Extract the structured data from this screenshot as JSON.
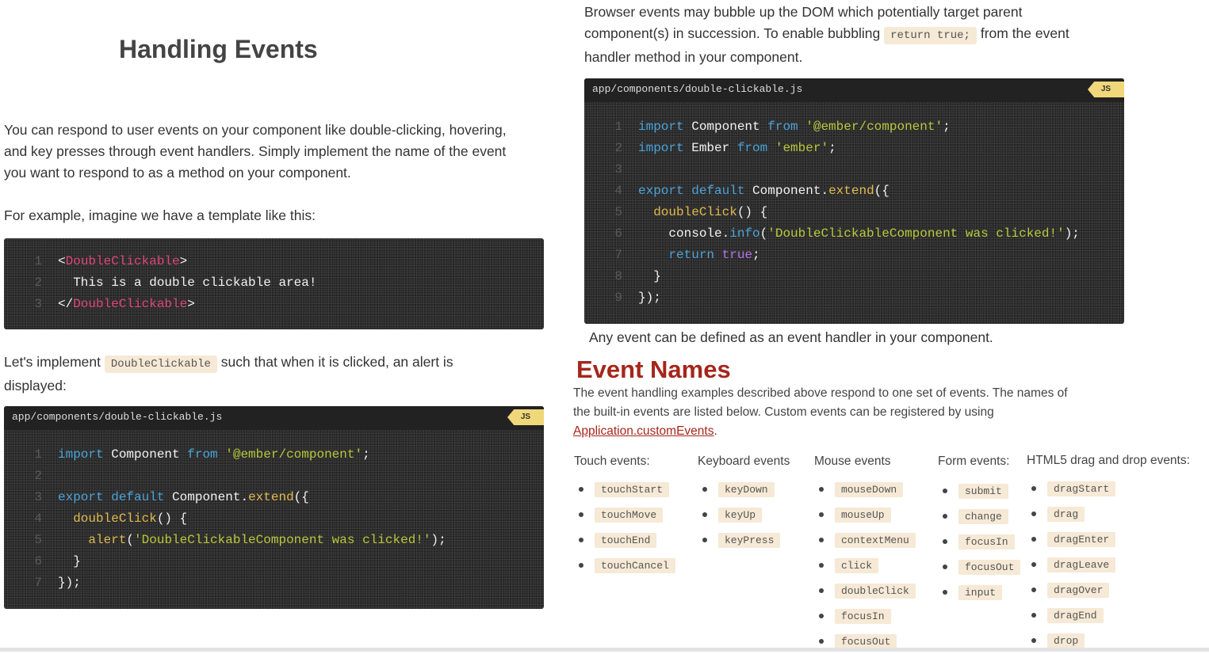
{
  "left": {
    "title": "Handling Events",
    "intro_lines": [
      "You can respond to user events on your component like double-clicking, hovering,",
      "and key presses through event handlers. Simply implement the name of the event",
      "you want to respond to as a method on your component."
    ],
    "example_intro": "For example, imagine we have a template like this:",
    "template_code": {
      "lines": [
        {
          "num": "1",
          "parts": [
            [
              "plain",
              "<"
            ],
            [
              "tag",
              "DoubleClickable"
            ],
            [
              "plain",
              ">"
            ]
          ]
        },
        {
          "num": "2",
          "parts": [
            [
              "plain",
              "  This is a double clickable area!"
            ]
          ]
        },
        {
          "num": "3",
          "parts": [
            [
              "plain",
              "</"
            ],
            [
              "tag",
              "DoubleClickable"
            ],
            [
              "plain",
              ">"
            ]
          ]
        }
      ]
    },
    "implement_pre": "Let's implement",
    "implement_code": "DoubleClickable",
    "implement_post": "such that when it is clicked, an alert is",
    "implement_post2": "displayed:",
    "code2": {
      "filename": "app/components/double-clickable.js",
      "lang": "JS",
      "lines": [
        {
          "num": "1",
          "parts": [
            [
              "kw",
              "import"
            ],
            [
              "plain",
              " Component "
            ],
            [
              "kw",
              "from"
            ],
            [
              "plain",
              " "
            ],
            [
              "str",
              "'@ember/component'"
            ],
            [
              "plain",
              ";"
            ]
          ]
        },
        {
          "num": "2",
          "parts": [
            [
              "plain",
              ""
            ]
          ]
        },
        {
          "num": "3",
          "parts": [
            [
              "kw",
              "export"
            ],
            [
              "plain",
              " "
            ],
            [
              "kw",
              "default"
            ],
            [
              "plain",
              " Component."
            ],
            [
              "fn",
              "extend"
            ],
            [
              "plain",
              "({"
            ]
          ]
        },
        {
          "num": "4",
          "parts": [
            [
              "plain",
              "  "
            ],
            [
              "fn",
              "doubleClick"
            ],
            [
              "plain",
              "() {"
            ]
          ]
        },
        {
          "num": "5",
          "parts": [
            [
              "plain",
              "    "
            ],
            [
              "fn",
              "alert"
            ],
            [
              "plain",
              "("
            ],
            [
              "str",
              "'DoubleClickableComponent was clicked!'"
            ],
            [
              "plain",
              ");"
            ]
          ]
        },
        {
          "num": "6",
          "parts": [
            [
              "plain",
              "  }"
            ]
          ]
        },
        {
          "num": "7",
          "parts": [
            [
              "plain",
              "});"
            ]
          ]
        }
      ]
    }
  },
  "right": {
    "bubble_line1": "Browser events may bubble up the DOM which potentially target parent",
    "bubble_line2_pre": "component(s) in succession. To enable bubbling",
    "bubble_code": "return true;",
    "bubble_line2_post": "from the event",
    "bubble_line3": "handler method in your component.",
    "code3": {
      "filename": "app/components/double-clickable.js",
      "lang": "JS",
      "lines": [
        {
          "num": "1",
          "parts": [
            [
              "kw",
              "import"
            ],
            [
              "plain",
              " Component "
            ],
            [
              "kw",
              "from"
            ],
            [
              "plain",
              " "
            ],
            [
              "str",
              "'@ember/component'"
            ],
            [
              "plain",
              ";"
            ]
          ]
        },
        {
          "num": "2",
          "parts": [
            [
              "kw",
              "import"
            ],
            [
              "plain",
              " Ember "
            ],
            [
              "kw",
              "from"
            ],
            [
              "plain",
              " "
            ],
            [
              "str",
              "'ember'"
            ],
            [
              "plain",
              ";"
            ]
          ]
        },
        {
          "num": "3",
          "parts": [
            [
              "plain",
              ""
            ]
          ]
        },
        {
          "num": "4",
          "parts": [
            [
              "kw",
              "export"
            ],
            [
              "plain",
              " "
            ],
            [
              "kw",
              "default"
            ],
            [
              "plain",
              " Component."
            ],
            [
              "fn",
              "extend"
            ],
            [
              "plain",
              "({"
            ]
          ]
        },
        {
          "num": "5",
          "parts": [
            [
              "plain",
              "  "
            ],
            [
              "fn",
              "doubleClick"
            ],
            [
              "plain",
              "() {"
            ]
          ]
        },
        {
          "num": "6",
          "parts": [
            [
              "plain",
              "    console."
            ],
            [
              "kw",
              "info"
            ],
            [
              "plain",
              "("
            ],
            [
              "str",
              "'DoubleClickableComponent was clicked!'"
            ],
            [
              "plain",
              ");"
            ]
          ]
        },
        {
          "num": "7",
          "parts": [
            [
              "plain",
              "    "
            ],
            [
              "kw",
              "return"
            ],
            [
              "plain",
              " "
            ],
            [
              "bool",
              "true"
            ],
            [
              "plain",
              ";"
            ]
          ]
        },
        {
          "num": "8",
          "parts": [
            [
              "plain",
              "  }"
            ]
          ]
        },
        {
          "num": "9",
          "parts": [
            [
              "plain",
              "});"
            ]
          ]
        }
      ]
    },
    "any_event": "Any event can be defined as an event handler in your component.",
    "event_names_title": "Event Names",
    "event_desc_line1": "The event handling examples described above respond to one set of events. The names of",
    "event_desc_line2": "the built-in events are listed below. Custom events can be registered by using",
    "event_desc_link": "Application.customEvents",
    "event_desc_link_tail": ".",
    "columns": [
      {
        "title": "Touch events:",
        "items": [
          "touchStart",
          "touchMove",
          "touchEnd",
          "touchCancel"
        ]
      },
      {
        "title": "Keyboard events",
        "items": [
          "keyDown",
          "keyUp",
          "keyPress"
        ]
      },
      {
        "title": "Mouse events",
        "items": [
          "mouseDown",
          "mouseUp",
          "contextMenu",
          "click",
          "doubleClick",
          "focusIn",
          "focusOut"
        ]
      },
      {
        "title": "Form events:",
        "items": [
          "submit",
          "change",
          "focusIn",
          "focusOut",
          "input"
        ]
      },
      {
        "title": "HTML5 drag and drop events:",
        "items": [
          "dragStart",
          "drag",
          "dragEnter",
          "dragLeave",
          "dragOver",
          "dragEnd",
          "drop"
        ]
      }
    ]
  }
}
